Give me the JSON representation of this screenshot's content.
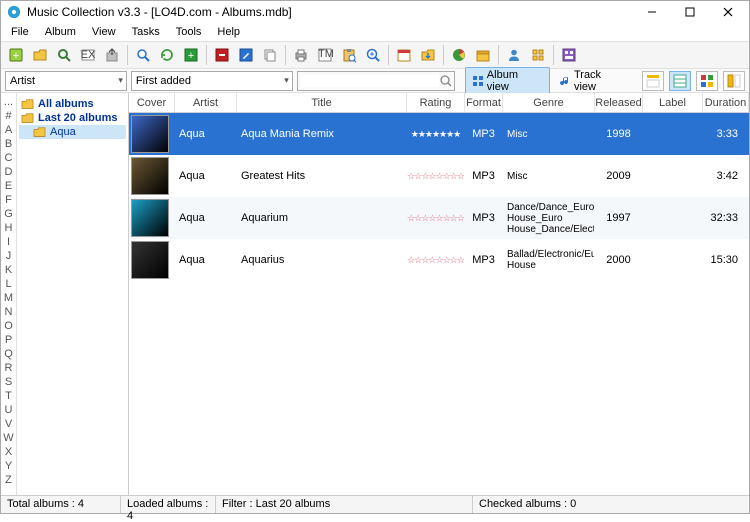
{
  "window": {
    "title": "Music Collection v3.3 - [LO4D.com - Albums.mdb]"
  },
  "menu": [
    "File",
    "Album",
    "View",
    "Tasks",
    "Tools",
    "Help"
  ],
  "filter": {
    "group": "Artist",
    "sort": "First added",
    "search": ""
  },
  "viewmodes": {
    "album": "Album view",
    "track": "Track view"
  },
  "alphastrip": [
    "...",
    "#",
    "A",
    "B",
    "C",
    "D",
    "E",
    "F",
    "G",
    "H",
    "I",
    "J",
    "K",
    "L",
    "M",
    "N",
    "O",
    "P",
    "Q",
    "R",
    "S",
    "T",
    "U",
    "V",
    "W",
    "X",
    "Y",
    "Z"
  ],
  "tree": [
    {
      "label": "All albums",
      "bold": true
    },
    {
      "label": "Last 20 albums",
      "bold": true
    },
    {
      "label": "Aqua",
      "bold": false,
      "selected": true
    }
  ],
  "columns": {
    "cover": "Cover",
    "artist": "Artist",
    "title": "Title",
    "rating": "Rating",
    "format": "Format",
    "genre": "Genre",
    "released": "Released",
    "label": "Label",
    "duration": "Duration"
  },
  "rows": [
    {
      "artist": "Aqua",
      "title": "Aqua Mania Remix",
      "rating": 7,
      "rating_max": 7,
      "filled": true,
      "format": "MP3",
      "genre": "Misc",
      "released": "1998",
      "label": "",
      "duration": "3:33",
      "selected": true,
      "cover": "#3e68c7"
    },
    {
      "artist": "Aqua",
      "title": "Greatest Hits",
      "rating": 10,
      "rating_max": 10,
      "filled": false,
      "format": "MP3",
      "genre": "Misc",
      "released": "2009",
      "label": "",
      "duration": "3:42",
      "cover": "#6b5834"
    },
    {
      "artist": "Aqua",
      "title": "Aquarium",
      "rating": 10,
      "rating_max": 10,
      "filled": false,
      "format": "MP3",
      "genre": "Dance/Dance_Euro House_Euro House_Dance/Electro",
      "released": "1997",
      "label": "",
      "duration": "32:33",
      "cover": "#1a9ec4"
    },
    {
      "artist": "Aqua",
      "title": "Aquarius",
      "rating": 10,
      "rating_max": 10,
      "filled": false,
      "format": "MP3",
      "genre": "Ballad/Electronic/Euro House",
      "released": "2000",
      "label": "",
      "duration": "15:30",
      "cover": "#333333"
    }
  ],
  "status": {
    "total": "Total albums : 4",
    "loaded": "Loaded albums : 4",
    "filter": "Filter : Last 20 albums",
    "checked": "Checked albums : 0"
  }
}
